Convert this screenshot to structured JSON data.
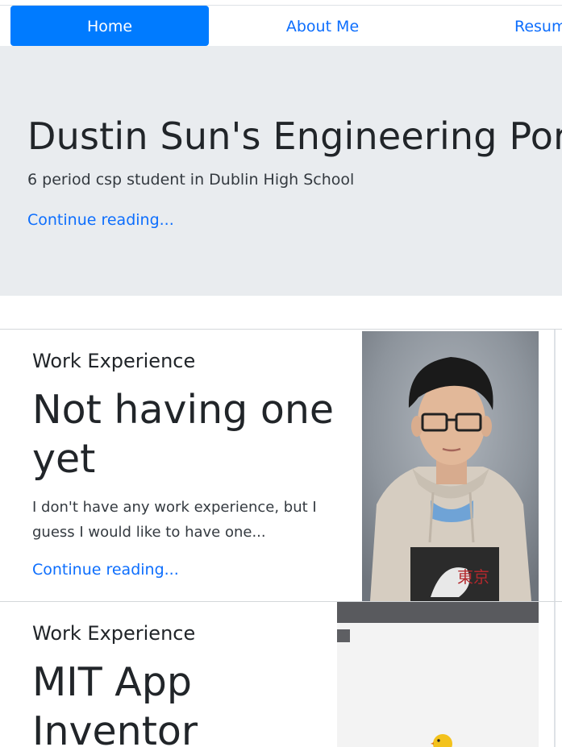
{
  "nav": {
    "home": "Home",
    "about": "About Me",
    "resume": "Resum"
  },
  "hero": {
    "title": "Dustin Sun's Engineering Port",
    "lead": "6 period csp student in Dublin High School",
    "link": "Continue reading..."
  },
  "cards": [
    {
      "category": "Work Experience",
      "title": "Not having one yet",
      "text": "I don't have any work experience, but I guess I would like to have one...",
      "link": "Continue reading..."
    },
    {
      "category": "Work Experience",
      "title": "MIT App Inventor"
    }
  ],
  "colors": {
    "primary": "#007bff",
    "link": "#0d6efd",
    "jumbotron_bg": "#e9ecef"
  }
}
